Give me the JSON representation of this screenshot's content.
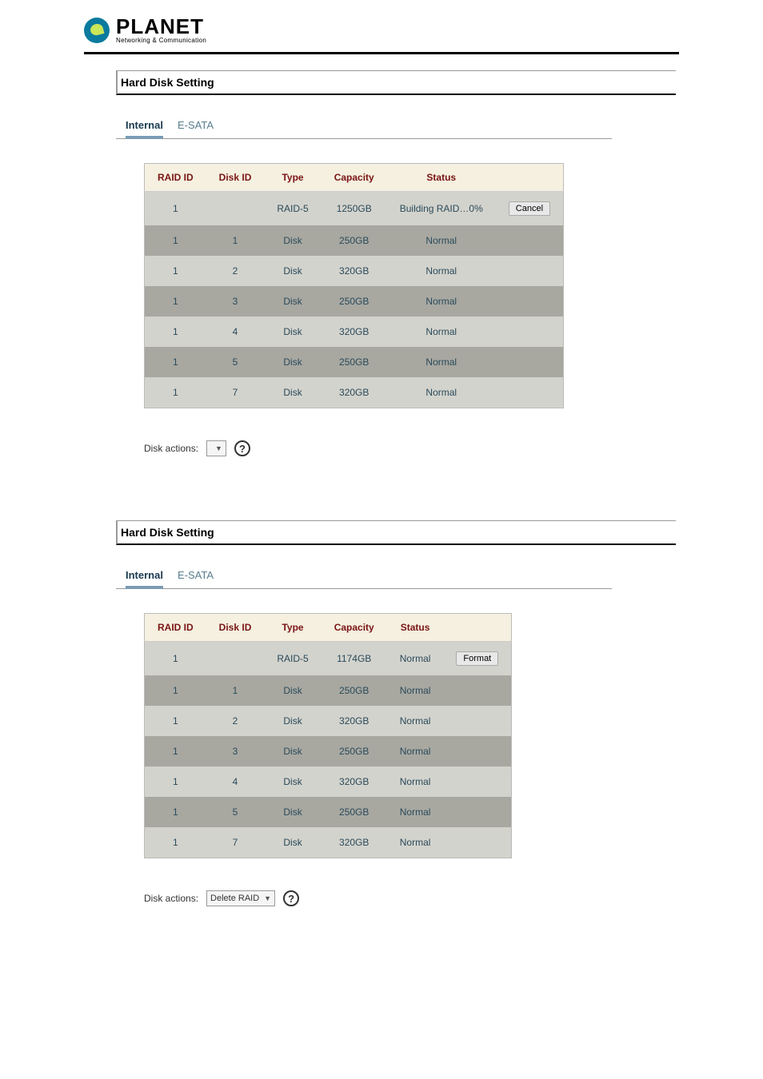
{
  "logo": {
    "main": "PLANET",
    "sub": "Networking & Communication"
  },
  "section1": {
    "title": "Hard Disk Setting",
    "tabs": {
      "internal": "Internal",
      "esata": "E-SATA"
    },
    "table": {
      "headers": {
        "raid_id": "RAID ID",
        "disk_id": "Disk ID",
        "type": "Type",
        "capacity": "Capacity",
        "status": "Status",
        "action": ""
      },
      "rows": [
        {
          "raid_id": "1",
          "disk_id": "",
          "type": "RAID-5",
          "capacity": "1250GB",
          "status": "Building RAID…0%",
          "button": "Cancel"
        },
        {
          "raid_id": "1",
          "disk_id": "1",
          "type": "Disk",
          "capacity": "250GB",
          "status": "Normal",
          "button": ""
        },
        {
          "raid_id": "1",
          "disk_id": "2",
          "type": "Disk",
          "capacity": "320GB",
          "status": "Normal",
          "button": ""
        },
        {
          "raid_id": "1",
          "disk_id": "3",
          "type": "Disk",
          "capacity": "250GB",
          "status": "Normal",
          "button": ""
        },
        {
          "raid_id": "1",
          "disk_id": "4",
          "type": "Disk",
          "capacity": "320GB",
          "status": "Normal",
          "button": ""
        },
        {
          "raid_id": "1",
          "disk_id": "5",
          "type": "Disk",
          "capacity": "250GB",
          "status": "Normal",
          "button": ""
        },
        {
          "raid_id": "1",
          "disk_id": "7",
          "type": "Disk",
          "capacity": "320GB",
          "status": "Normal",
          "button": ""
        }
      ]
    },
    "actions": {
      "label": "Disk actions:",
      "selected": ""
    }
  },
  "section2": {
    "title": "Hard Disk Setting",
    "tabs": {
      "internal": "Internal",
      "esata": "E-SATA"
    },
    "table": {
      "headers": {
        "raid_id": "RAID ID",
        "disk_id": "Disk ID",
        "type": "Type",
        "capacity": "Capacity",
        "status": "Status",
        "action": ""
      },
      "rows": [
        {
          "raid_id": "1",
          "disk_id": "",
          "type": "RAID-5",
          "capacity": "1174GB",
          "status": "Normal",
          "button": "Format"
        },
        {
          "raid_id": "1",
          "disk_id": "1",
          "type": "Disk",
          "capacity": "250GB",
          "status": "Normal",
          "button": ""
        },
        {
          "raid_id": "1",
          "disk_id": "2",
          "type": "Disk",
          "capacity": "320GB",
          "status": "Normal",
          "button": ""
        },
        {
          "raid_id": "1",
          "disk_id": "3",
          "type": "Disk",
          "capacity": "250GB",
          "status": "Normal",
          "button": ""
        },
        {
          "raid_id": "1",
          "disk_id": "4",
          "type": "Disk",
          "capacity": "320GB",
          "status": "Normal",
          "button": ""
        },
        {
          "raid_id": "1",
          "disk_id": "5",
          "type": "Disk",
          "capacity": "250GB",
          "status": "Normal",
          "button": ""
        },
        {
          "raid_id": "1",
          "disk_id": "7",
          "type": "Disk",
          "capacity": "320GB",
          "status": "Normal",
          "button": ""
        }
      ]
    },
    "actions": {
      "label": "Disk actions:",
      "selected": "Delete RAID"
    }
  }
}
